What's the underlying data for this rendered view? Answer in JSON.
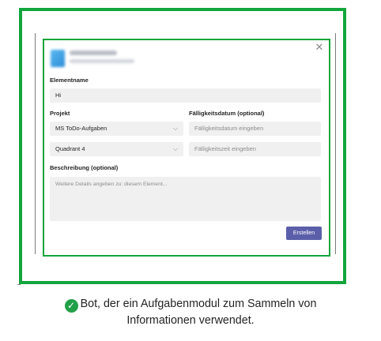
{
  "dialog": {
    "close_glyph": "✕",
    "item_name_label": "Elementname",
    "item_name_value": "Hi",
    "project_label": "Projekt",
    "project_value": "MS ToDo-Aufgaben",
    "quadrant_value": "Quadrant 4",
    "due_date_label": "Fälligkeitsdatum (optional)",
    "due_date_placeholder": "Fälligkeitsdatum eingeben",
    "due_time_placeholder": "Fälligkeitszeit eingeben",
    "description_label": "Beschreibung (optional)",
    "description_placeholder": "Weitere Details angeben zu: diesem Element...",
    "create_button_label": "Erstellen",
    "chevron_glyph": "⌵"
  },
  "caption": {
    "line1": "Bot, der ein Aufgabenmodul zum Sammeln von",
    "line2": "Informationen verwendet.",
    "check_glyph": "✓"
  },
  "colors": {
    "frame_green": "#12a53c",
    "check_green": "#22a048",
    "button_purple": "#5b5fa9",
    "field_gray": "#f0f0f0"
  }
}
